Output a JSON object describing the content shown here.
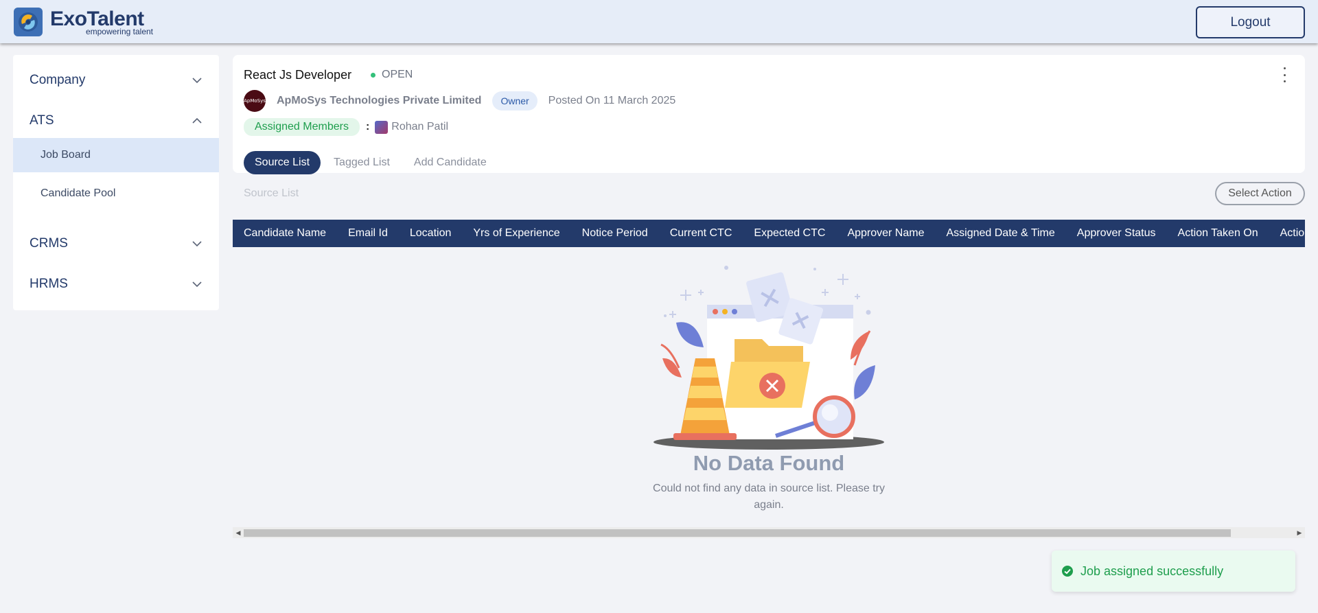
{
  "header": {
    "brand_name": "ExoTalent",
    "brand_tagline": "empowering talent",
    "logout_label": "Logout"
  },
  "sidebar": {
    "groups": [
      {
        "label": "Company",
        "expanded": false
      },
      {
        "label": "ATS",
        "expanded": true,
        "items": [
          "Job Board",
          "Candidate Pool"
        ]
      },
      {
        "label": "CRMS",
        "expanded": false
      },
      {
        "label": "HRMS",
        "expanded": false
      }
    ],
    "active_item": "Job Board"
  },
  "job": {
    "title": "React Js Developer",
    "status": "OPEN",
    "company_logo_text": "ApMoSys",
    "company_name": "ApMoSys Technologies Private Limited",
    "role_badge": "Owner",
    "posted": "Posted On 11 March 2025",
    "assigned_label": "Assigned Members",
    "assigned_separator": ":",
    "member_name": "Rohan Patil"
  },
  "tabs": [
    "Source List",
    "Tagged List",
    "Add Candidate"
  ],
  "list": {
    "title": "Source List",
    "select_action_label": "Select Action"
  },
  "table": {
    "columns": [
      "Candidate Name",
      "Email Id",
      "Location",
      "Yrs of Experience",
      "Notice Period",
      "Current CTC",
      "Expected CTC",
      "Approver Name",
      "Assigned Date & Time",
      "Approver Status",
      "Action Taken On",
      "Action"
    ]
  },
  "empty_state": {
    "title": "No Data Found",
    "description": "Could not find any data in source list. Please try again."
  },
  "scrollbar": {
    "left_arrow": "◀",
    "right_arrow": "▶"
  },
  "toast": {
    "message": "Job assigned successfully"
  },
  "colors": {
    "brand": "#233a6a",
    "success": "#1e9e4d",
    "status_dot": "#34c07a"
  }
}
